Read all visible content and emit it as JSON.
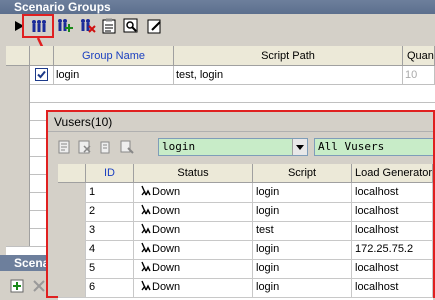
{
  "window": {
    "title": "Scenario Groups"
  },
  "back_grid": {
    "headers": [
      "Group Name",
      "Script Path",
      "Quant"
    ],
    "rows": [
      {
        "checked": true,
        "group": "login",
        "path": "test, login",
        "quantity": "10"
      }
    ]
  },
  "bottom_panel": {
    "title": "Scena"
  },
  "vusers": {
    "title": "Vusers(10)",
    "group_filter": "login",
    "status_filter": "All Vusers",
    "headers": [
      "ID",
      "Status",
      "Script",
      "Load Generator"
    ],
    "rows": [
      {
        "id": "1",
        "status": "Down",
        "script": "login",
        "generator": "localhost"
      },
      {
        "id": "2",
        "status": "Down",
        "script": "login",
        "generator": "localhost"
      },
      {
        "id": "3",
        "status": "Down",
        "script": "test",
        "generator": "localhost"
      },
      {
        "id": "4",
        "status": "Down",
        "script": "login",
        "generator": "172.25.75.2"
      },
      {
        "id": "5",
        "status": "Down",
        "script": "login",
        "generator": "localhost"
      },
      {
        "id": "6",
        "status": "Down",
        "script": "login",
        "generator": "localhost"
      }
    ]
  },
  "colors": {
    "highlight": "#e02020",
    "header_text": "#1a3fc0",
    "combo_bg": "#c8ecc8"
  }
}
